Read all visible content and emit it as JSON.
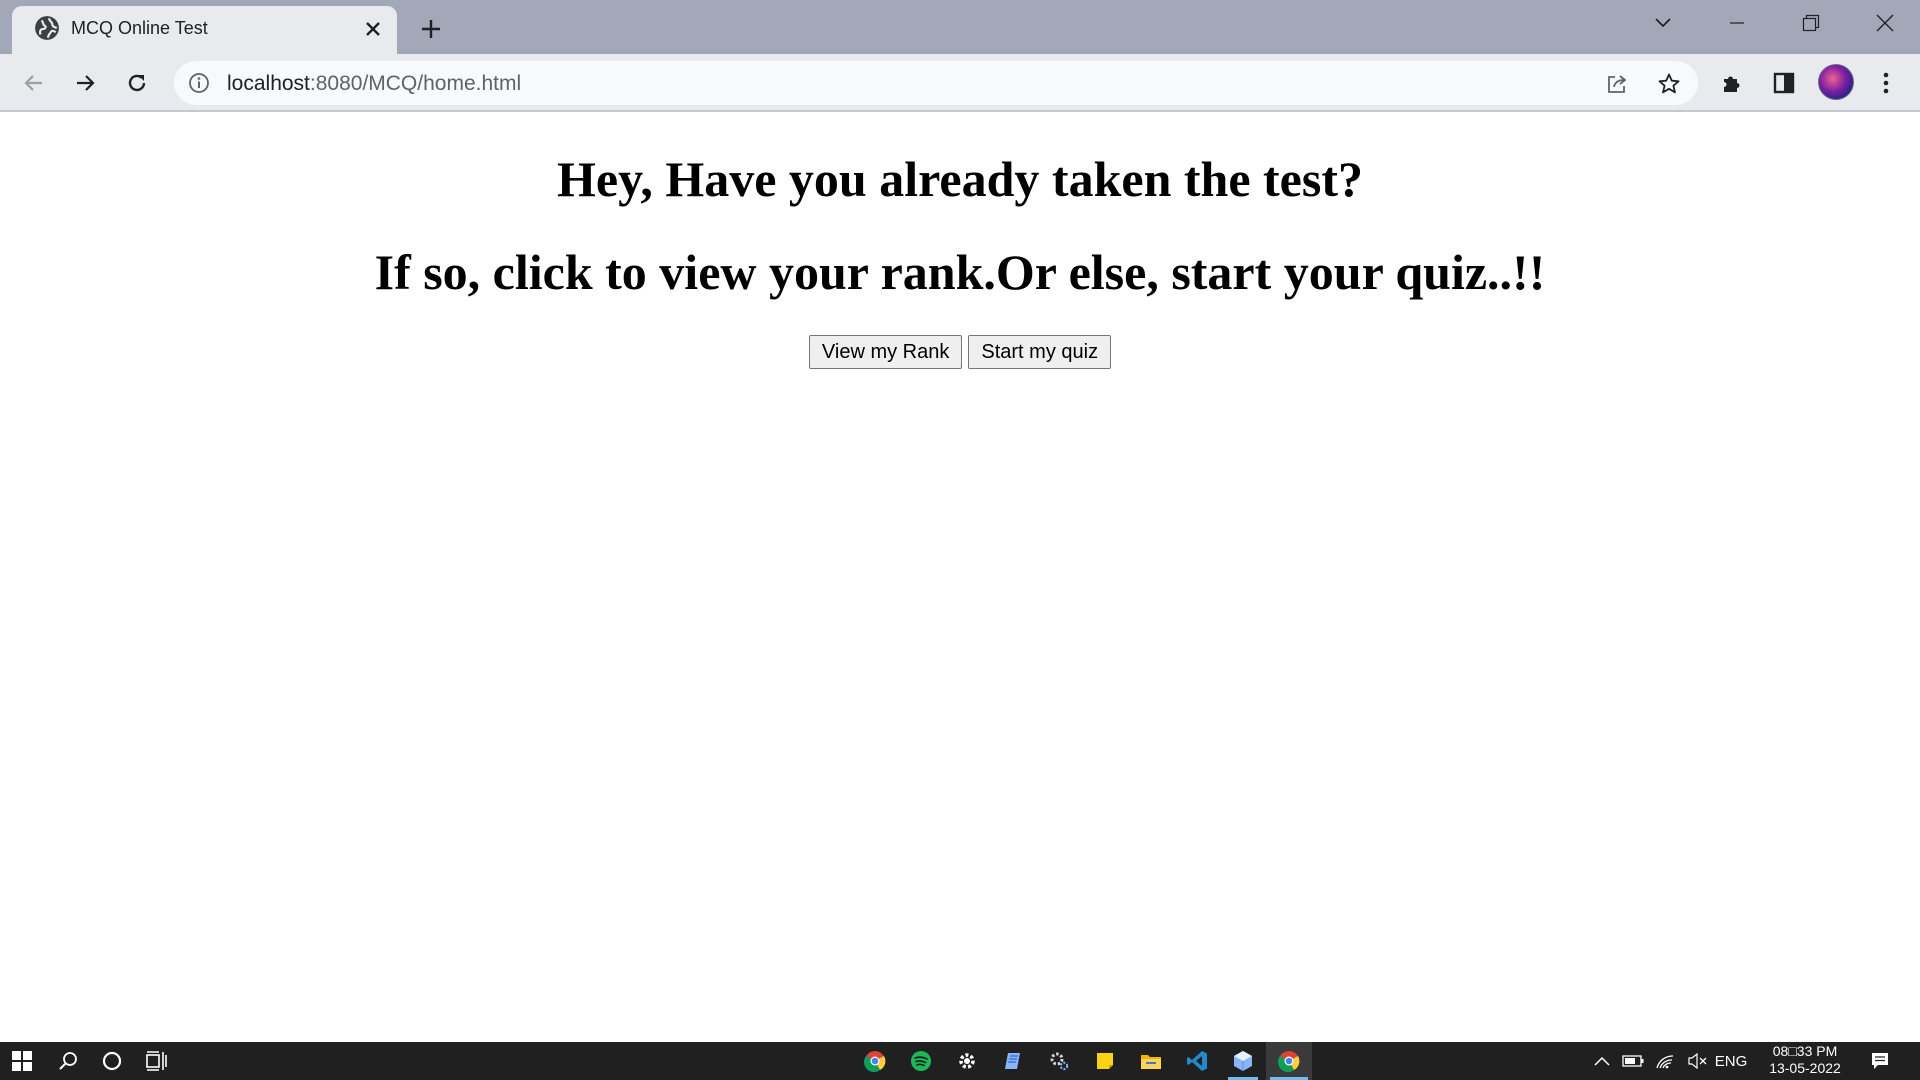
{
  "browser": {
    "tab": {
      "title": "MCQ Online Test",
      "favicon": "globe-icon"
    },
    "address": {
      "host": "localhost",
      "rest": ":8080/MCQ/home.html"
    }
  },
  "page": {
    "heading_1": "Hey, Have you already taken the test?",
    "heading_2": "If so, click to view your rank.Or else, start your quiz..!!",
    "buttons": {
      "view_rank": "View my Rank",
      "start_quiz": "Start my quiz"
    }
  },
  "taskbar": {
    "language": "ENG",
    "time": "08□33 PM",
    "date": "13-05-2022",
    "pinned_apps": [
      "chrome-icon",
      "spotify-icon",
      "settings-icon",
      "app-icon",
      "settings-gear-icon",
      "sticky-notes-icon",
      "file-explorer-icon",
      "vscode-icon",
      "cube-app-icon",
      "chrome-active-icon"
    ]
  },
  "colors": {
    "titlebar": "#a3a8b8",
    "tab_active": "#e8eaed",
    "taskbar": "#202020"
  }
}
